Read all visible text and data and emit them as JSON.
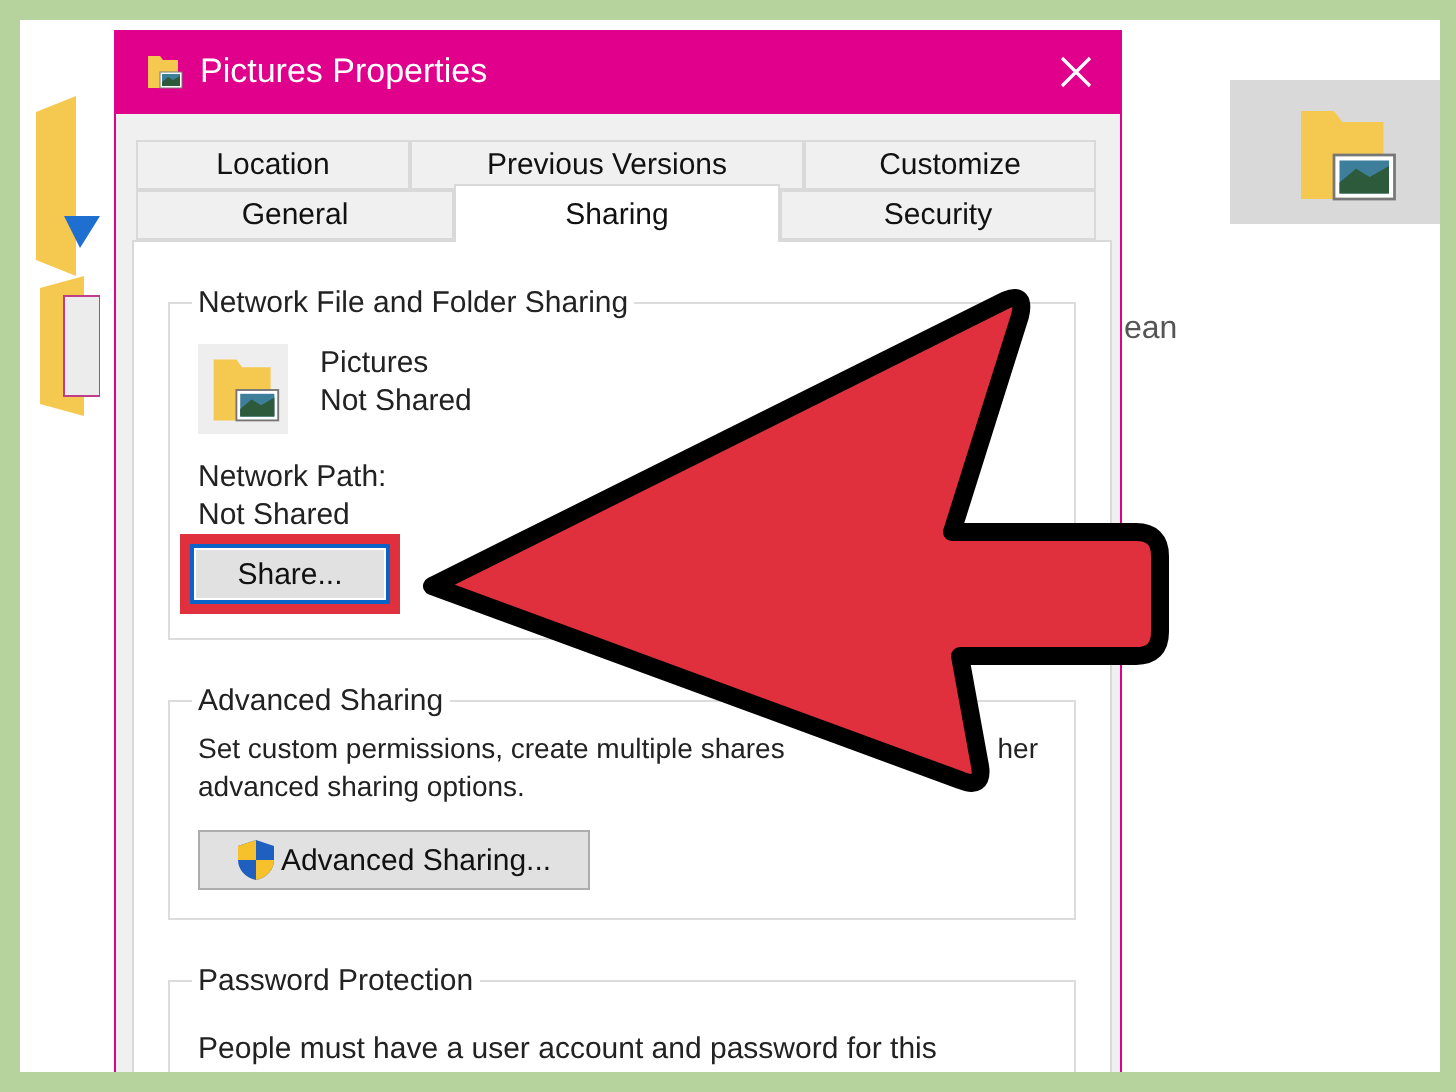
{
  "background": {
    "fragment": "ean"
  },
  "window": {
    "title": "Pictures Properties"
  },
  "tab_rows": [
    [
      {
        "label": "Location",
        "selected": false
      },
      {
        "label": "Previous Versions",
        "selected": false
      },
      {
        "label": "Customize",
        "selected": false
      }
    ],
    [
      {
        "label": "General",
        "selected": false
      },
      {
        "label": "Sharing",
        "selected": true
      },
      {
        "label": "Security",
        "selected": false
      }
    ]
  ],
  "network_sharing": {
    "title": "Network File and Folder Sharing",
    "item_name": "Pictures",
    "item_status": "Not Shared",
    "path_label": "Network Path:",
    "path_value": "Not Shared",
    "button": {
      "label": "Share...",
      "highlighted": true
    }
  },
  "advanced_sharing": {
    "title": "Advanced Sharing",
    "description": [
      {
        "parts": [
          "Set custom permissions, create multiple shares",
          "her"
        ]
      },
      {
        "parts": [
          "advanced sharing options."
        ]
      }
    ],
    "button": {
      "label": "Advanced Sharing..."
    }
  },
  "password_protection": {
    "title": "Password Protection",
    "description": "People must have a user account and password for this"
  }
}
